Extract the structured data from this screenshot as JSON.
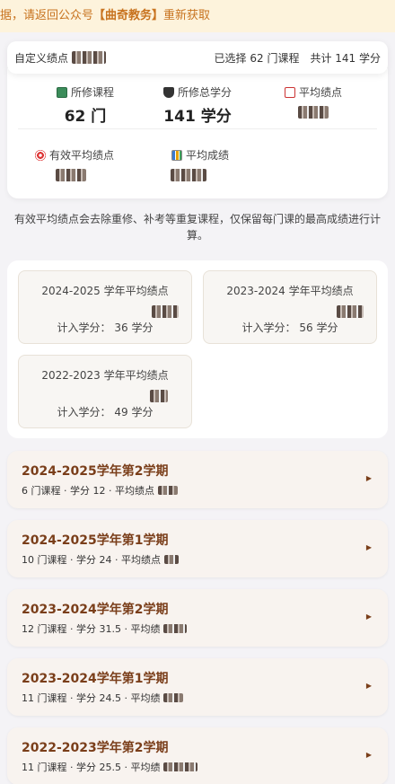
{
  "banner": {
    "prefix": "据，请返回公众号",
    "highlight": "【曲奇教务】",
    "suffix": "重新获取"
  },
  "summary_bar": {
    "label": "自定义绩点",
    "selected": "已选择 62 门课程",
    "total": "共计 141 学分"
  },
  "stats": {
    "courses": {
      "label": "所修课程",
      "value": "62 门"
    },
    "credits": {
      "label": "所修总学分",
      "value": "141 学分"
    },
    "gpa": {
      "label": "平均绩点"
    },
    "effective_gpa": {
      "label": "有效平均绩点"
    },
    "avg_score": {
      "label": "平均成绩"
    }
  },
  "note": "有效平均绩点会去除重修、补考等重复课程，仅保留每门课的最高成绩进行计算。",
  "years": [
    {
      "title": "2024-2025 学年平均绩点",
      "credits": "计入学分： 36 学分"
    },
    {
      "title": "2023-2024 学年平均绩点",
      "credits": "计入学分： 56 学分"
    },
    {
      "title": "2022-2023 学年平均绩点",
      "credits": "计入学分： 49 学分"
    }
  ],
  "terms": [
    {
      "name": "2024-2025学年第2学期",
      "meta": "6 门课程 · 学分 12 · 平均绩点"
    },
    {
      "name": "2024-2025学年第1学期",
      "meta": "10 门课程 · 学分 24 · 平均绩点"
    },
    {
      "name": "2023-2024学年第2学期",
      "meta": "12 门课程 · 学分 31.5 · 平均绩"
    },
    {
      "name": "2023-2024学年第1学期",
      "meta": "11 门课程 · 学分 24.5 · 平均绩"
    },
    {
      "name": "2022-2023学年第2学期",
      "meta": "11 门课程 · 学分 25.5 · 平均绩"
    }
  ],
  "icons": {
    "courses": "book-icon",
    "credits": "graduation-cap-icon",
    "gpa": "chart-icon",
    "effective_gpa": "target-icon",
    "avg_score": "bar-chart-icon",
    "term_arrow": "triangle-right-icon"
  }
}
